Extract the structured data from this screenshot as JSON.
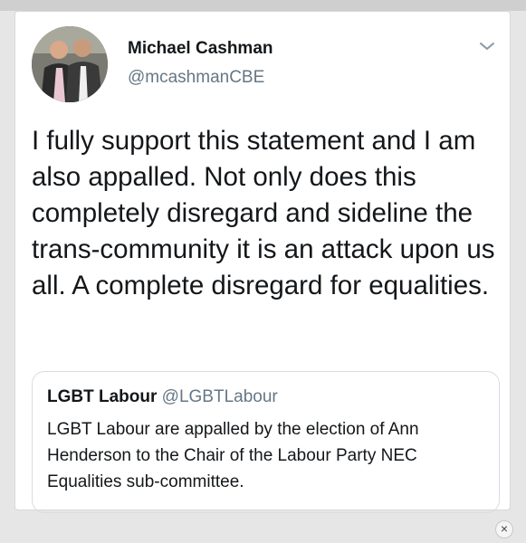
{
  "tweet": {
    "author_name": "Michael Cashman",
    "author_handle": "@mcashmanCBE",
    "text": "I fully support this statement and I am also appalled.  Not only does this completely disregard and sideline the trans-community it is an attack upon us all. A complete disregard for equalities."
  },
  "quoted_tweet": {
    "author_name": "LGBT Labour",
    "author_handle": "@LGBTLabour",
    "text": "LGBT Labour are appalled by the election of Ann Henderson to the Chair of the Labour Party NEC Equalities sub-committee."
  },
  "icons": {
    "menu": "chevron-down-icon",
    "close": "close-icon"
  },
  "close_label": "×",
  "colors": {
    "text": "#14171a",
    "secondary": "#657786",
    "border": "#d6dde3"
  }
}
